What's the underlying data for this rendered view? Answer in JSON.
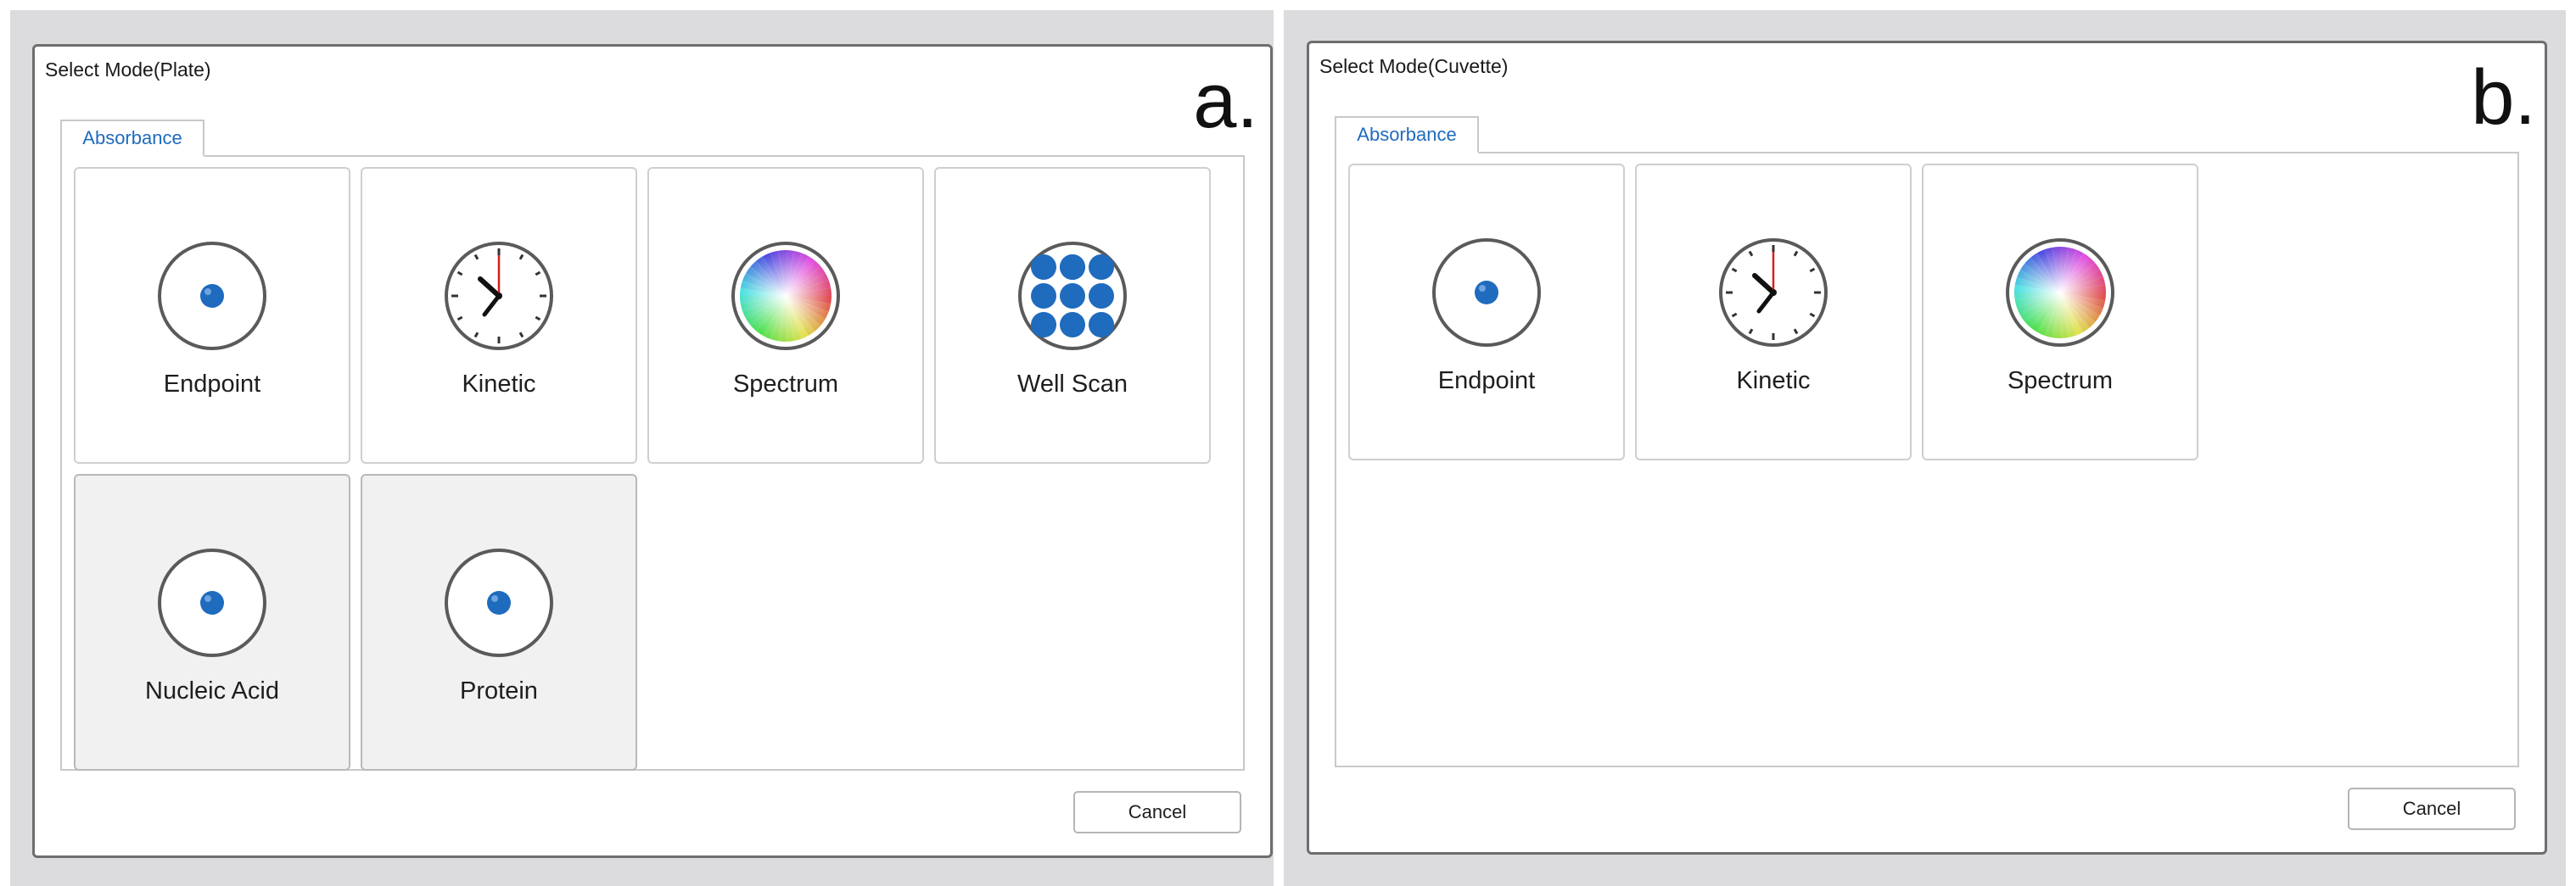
{
  "colors": {
    "accent": "#1f6bbd",
    "well": "#1f6bbd",
    "clock_second_hand": "#d42020"
  },
  "panels": [
    {
      "letter": "a.",
      "title": "Select Mode(Plate)",
      "tab_label": "Absorbance",
      "cancel_label": "Cancel",
      "modes": [
        {
          "label": "Endpoint",
          "icon": "endpoint-icon",
          "enabled": true
        },
        {
          "label": "Kinetic",
          "icon": "clock-icon",
          "enabled": true
        },
        {
          "label": "Spectrum",
          "icon": "color-wheel-icon",
          "enabled": true
        },
        {
          "label": "Well Scan",
          "icon": "well-grid-icon",
          "enabled": true
        },
        {
          "label": "Nucleic Acid",
          "icon": "endpoint-icon",
          "enabled": false
        },
        {
          "label": "Protein",
          "icon": "endpoint-icon",
          "enabled": false
        }
      ]
    },
    {
      "letter": "b.",
      "title": "Select Mode(Cuvette)",
      "tab_label": "Absorbance",
      "cancel_label": "Cancel",
      "modes": [
        {
          "label": "Endpoint",
          "icon": "endpoint-icon",
          "enabled": true
        },
        {
          "label": "Kinetic",
          "icon": "clock-icon",
          "enabled": true
        },
        {
          "label": "Spectrum",
          "icon": "color-wheel-icon",
          "enabled": true
        }
      ]
    }
  ]
}
